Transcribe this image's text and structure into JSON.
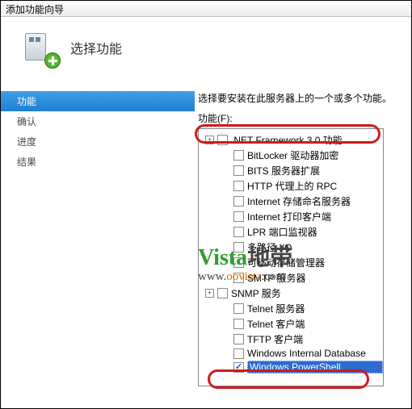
{
  "window": {
    "title": "添加功能向导"
  },
  "header": {
    "title": "选择功能"
  },
  "sidebar": {
    "items": [
      {
        "label": "功能",
        "selected": true
      },
      {
        "label": "确认",
        "selected": false
      },
      {
        "label": "进度",
        "selected": false
      },
      {
        "label": "结果",
        "selected": false
      }
    ]
  },
  "main": {
    "intro": "选择要安装在此服务器上的一个或多个功能。",
    "list_label": "功能(F):",
    "features": [
      {
        "label": ".NET Framework 3.0 功能",
        "checked": false,
        "expander": "+",
        "indent": false
      },
      {
        "label": "BitLocker 驱动器加密",
        "checked": false,
        "expander": "",
        "indent": true
      },
      {
        "label": "BITS 服务器扩展",
        "checked": false,
        "expander": "",
        "indent": true
      },
      {
        "label": "HTTP 代理上的 RPC",
        "checked": false,
        "expander": "",
        "indent": true
      },
      {
        "label": "Internet 存储命名服务器",
        "checked": false,
        "expander": "",
        "indent": true
      },
      {
        "label": "Internet 打印客户端",
        "checked": false,
        "expander": "",
        "indent": true
      },
      {
        "label": "LPR 端口监视器",
        "checked": false,
        "expander": "",
        "indent": true
      },
      {
        "label": "多路径 I/O",
        "checked": false,
        "expander": "",
        "indent": true
      },
      {
        "label": "可移动存储管理器",
        "checked": false,
        "expander": "",
        "indent": true
      },
      {
        "label": "SMTP 服务器",
        "checked": false,
        "expander": "",
        "indent": true
      },
      {
        "label": "SNMP 服务",
        "checked": false,
        "expander": "+",
        "indent": false
      },
      {
        "label": "Telnet 服务器",
        "checked": false,
        "expander": "",
        "indent": true
      },
      {
        "label": "Telnet 客户端",
        "checked": false,
        "expander": "",
        "indent": true
      },
      {
        "label": "TFTP 客户端",
        "checked": false,
        "expander": "",
        "indent": true
      },
      {
        "label": "Windows Internal Database",
        "checked": false,
        "expander": "",
        "indent": true
      },
      {
        "label": "Windows PowerShell",
        "checked": true,
        "expander": "",
        "indent": true,
        "selected": true
      }
    ]
  },
  "watermark": {
    "line1_a": "Vista",
    "line1_b": "地带",
    "line2_pre": "www.",
    "line2_mid": "oovista",
    "line2_post": ".com"
  }
}
